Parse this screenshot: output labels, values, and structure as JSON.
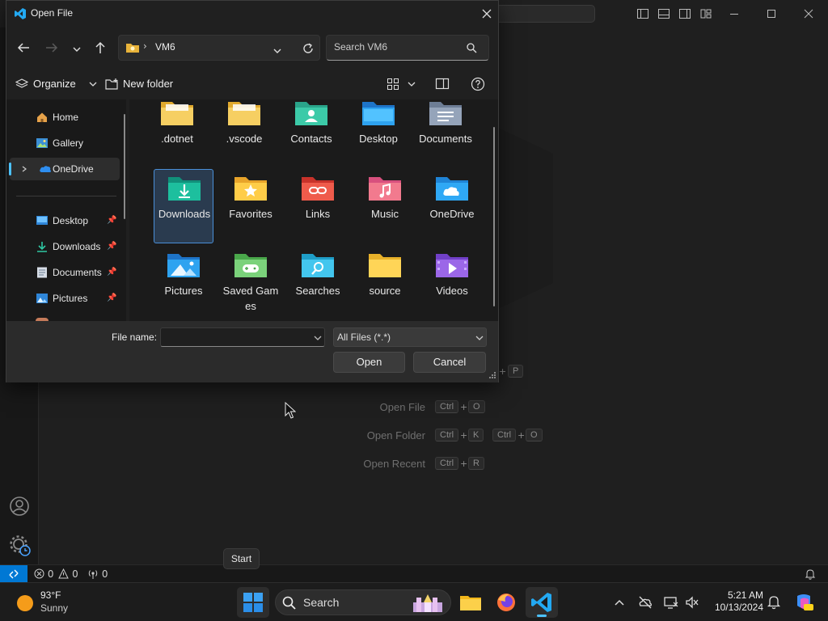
{
  "vscode": {
    "shortcuts": [
      {
        "label": "Open File",
        "keys": [
          "Ctrl",
          "O"
        ]
      },
      {
        "label": "Open Folder",
        "keys": [
          "Ctrl",
          "K"
        ],
        "keys2": [
          "Ctrl",
          "O"
        ]
      },
      {
        "label": "Open Recent",
        "keys": [
          "Ctrl",
          "R"
        ]
      }
    ],
    "partial_key": "P",
    "status": {
      "errors": "0",
      "warnings": "0",
      "ports": "0"
    }
  },
  "dialog": {
    "title": "Open File",
    "address": {
      "folder": "VM6"
    },
    "search_placeholder": "Search VM6",
    "toolbar": {
      "organize": "Organize",
      "new_folder": "New folder"
    },
    "nav_items": [
      {
        "label": "Home",
        "icon": "home-icon"
      },
      {
        "label": "Gallery",
        "icon": "gallery-icon"
      },
      {
        "label": "OneDrive",
        "icon": "onedrive-icon"
      },
      {
        "label": "Desktop",
        "icon": "desktop-icon"
      },
      {
        "label": "Downloads",
        "icon": "downloads-icon"
      },
      {
        "label": "Documents",
        "icon": "documents-icon"
      },
      {
        "label": "Pictures",
        "icon": "pictures-icon"
      }
    ],
    "folders": [
      {
        "name": ".dotnet"
      },
      {
        "name": ".vscode"
      },
      {
        "name": "Contacts"
      },
      {
        "name": "Desktop"
      },
      {
        "name": "Documents"
      },
      {
        "name": "Downloads"
      },
      {
        "name": "Favorites"
      },
      {
        "name": "Links"
      },
      {
        "name": "Music"
      },
      {
        "name": "OneDrive"
      },
      {
        "name": "Pictures"
      },
      {
        "name": "Saved Games"
      },
      {
        "name": "Searches"
      },
      {
        "name": "source"
      },
      {
        "name": "Videos"
      }
    ],
    "file_name_label": "File name:",
    "file_name_value": "",
    "file_type": "All Files (*.*)",
    "open_label": "Open",
    "cancel_label": "Cancel"
  },
  "tooltip": {
    "start": "Start"
  },
  "taskbar": {
    "weather_temp": "93°F",
    "weather_desc": "Sunny",
    "search_label": "Search",
    "time": "5:21 AM",
    "date": "10/13/2024"
  },
  "colors": {
    "accent": "#0078d4",
    "selected_border": "#4a8fd8",
    "folder_yellow": "#f3c64b"
  }
}
